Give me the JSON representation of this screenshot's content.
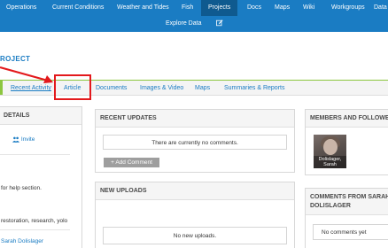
{
  "nav": {
    "row1": [
      "Operations",
      "Current Conditions",
      "Weather and Tides",
      "Fish",
      "Projects",
      "Docs",
      "Maps",
      "Wiki",
      "Workgroups",
      "Data"
    ],
    "row2": [
      "Explore Data"
    ],
    "active": "Projects",
    "edit_icon": "edit-icon"
  },
  "project": {
    "title_fragment": "ROJECT"
  },
  "tabs": [
    "Recent Activity",
    "Article",
    "Documents",
    "Images & Video",
    "Maps",
    "Summaries & Reports"
  ],
  "left_panel": {
    "title": "DETAILS",
    "invite_label": "Invite",
    "help_text": "for help section.",
    "tags_text": "restoration, research, yolo",
    "owner": "Sarah Dolislager"
  },
  "recent_updates": {
    "title": "RECENT UPDATES",
    "empty": "There are currently no comments.",
    "add_button": "Add Comment"
  },
  "new_uploads": {
    "title": "NEW UPLOADS",
    "empty": "No new uploads."
  },
  "members": {
    "title": "MEMBERS AND FOLLOWE",
    "member_name": "Dolislager, Sarah"
  },
  "comments_from": {
    "title_line1": "COMMENTS FROM SARAH",
    "title_line2": "DOLISLAGER",
    "empty": "No comments yet"
  },
  "colors": {
    "nav_blue": "#1a7cc3",
    "nav_active": "#0f5a8f",
    "accent_green": "#8cc63f",
    "annotation_red": "#e3191c"
  }
}
